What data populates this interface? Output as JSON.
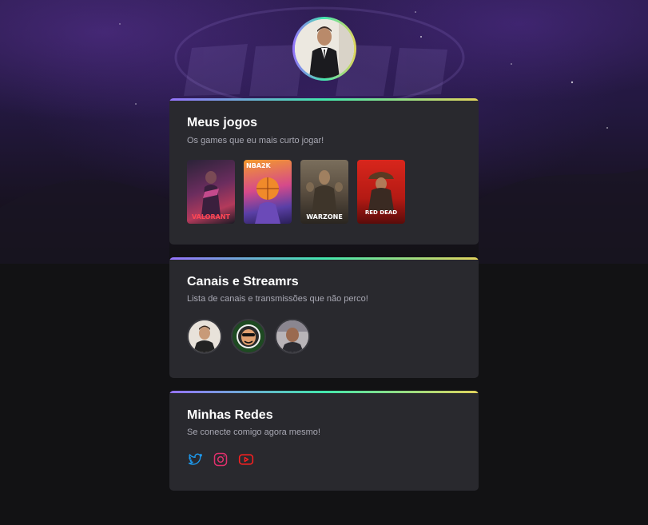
{
  "profile": {
    "avatar": "profile-photo"
  },
  "games_card": {
    "title": "Meus jogos",
    "subtitle": "Os games que eu mais curto jogar!",
    "games": [
      {
        "name": "VALORANT",
        "caption": "VALORANT"
      },
      {
        "name": "NBA 2K23",
        "caption": "NBA2K"
      },
      {
        "name": "Call of Duty Warzone",
        "caption": "WARZONE"
      },
      {
        "name": "Red Dead Redemption II",
        "caption": "RED DEAD"
      }
    ]
  },
  "streamers_card": {
    "title": "Canais e Streamrs",
    "subtitle": "Lista de canais e transmissões que não perco!",
    "streamers": [
      "streamer-1",
      "streamer-2",
      "streamer-3"
    ]
  },
  "socials_card": {
    "title": "Minhas Redes",
    "subtitle": "Se conecte comigo agora mesmo!",
    "links": [
      {
        "icon": "twitter-icon",
        "color": "#1d9bf0"
      },
      {
        "icon": "instagram-icon",
        "color": "#e1306c"
      },
      {
        "icon": "youtube-icon",
        "color": "#ff0000"
      }
    ]
  },
  "colors": {
    "gradient": [
      "#9572fc",
      "#43e7ad",
      "#e2d45c"
    ],
    "card_bg": "#29292e",
    "page_bg": "#121214"
  }
}
